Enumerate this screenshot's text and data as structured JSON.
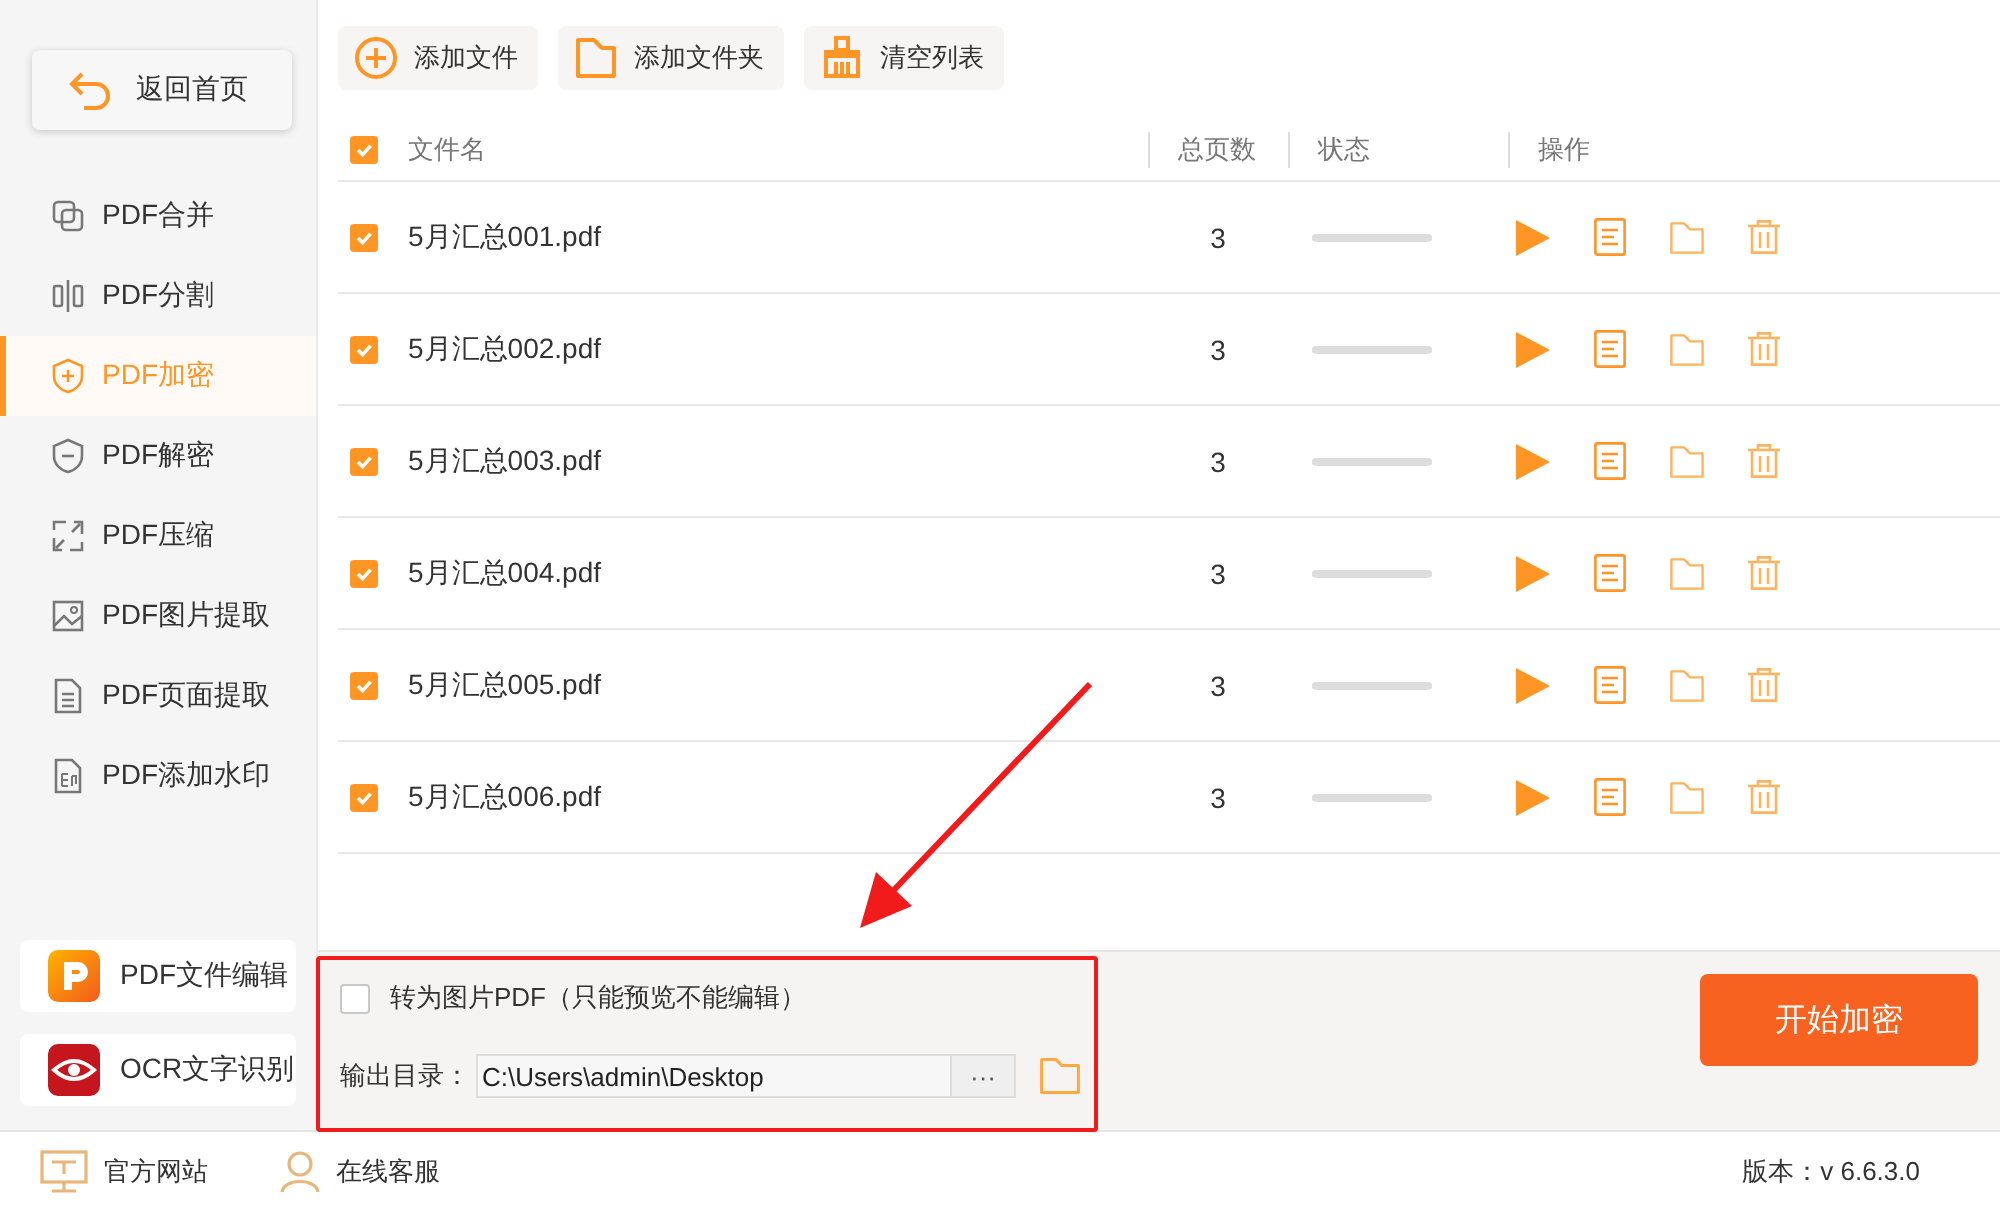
{
  "sidebar": {
    "back_button": "返回首页",
    "items": [
      {
        "label": "PDF合并",
        "kind": "merge",
        "selected": false
      },
      {
        "label": "PDF分割",
        "kind": "split",
        "selected": false
      },
      {
        "label": "PDF加密",
        "kind": "encrypt",
        "selected": true
      },
      {
        "label": "PDF解密",
        "kind": "decrypt",
        "selected": false
      },
      {
        "label": "PDF压缩",
        "kind": "compress",
        "selected": false
      },
      {
        "label": "PDF图片提取",
        "kind": "image",
        "selected": false
      },
      {
        "label": "PDF页面提取",
        "kind": "page",
        "selected": false
      },
      {
        "label": "PDF添加水印",
        "kind": "watermark",
        "selected": false
      }
    ],
    "extras": [
      {
        "label": "PDF文件编辑",
        "kind": "edit"
      },
      {
        "label": "OCR文字识别",
        "kind": "ocr"
      }
    ]
  },
  "toolbar": [
    {
      "label": "添加文件",
      "kind": "add-file"
    },
    {
      "label": "添加文件夹",
      "kind": "add-folder"
    },
    {
      "label": "清空列表",
      "kind": "clear"
    }
  ],
  "table": {
    "all_checked": true,
    "columns": [
      "文件名",
      "总页数",
      "状态",
      "操作"
    ],
    "rows": [
      {
        "checked": true,
        "name": "5月汇总001.pdf",
        "pages": "3",
        "level": 0
      },
      {
        "checked": true,
        "name": "5月汇总002.pdf",
        "pages": "3",
        "level": 0
      },
      {
        "checked": true,
        "name": "5月汇总003.pdf",
        "pages": "3",
        "level": 0
      },
      {
        "checked": true,
        "name": "5月汇总004.pdf",
        "pages": "3",
        "level": 0
      },
      {
        "checked": true,
        "name": "5月汇总005.pdf",
        "pages": "3",
        "level": 0
      },
      {
        "checked": true,
        "name": "5月汇总006.pdf",
        "pages": "3",
        "level": 0
      }
    ]
  },
  "options": {
    "convert_checked": false,
    "convert_label": "转为图片PDF（只能预览不能编辑）",
    "output_label": "输出目录：",
    "output_path": "C:\\Users\\admin\\Desktop",
    "browse_button": "···"
  },
  "start_button": "开始加密",
  "footer": {
    "links": [
      {
        "label": "官方网站",
        "kind": "website"
      },
      {
        "label": "在线客服",
        "kind": "support"
      }
    ],
    "version": "版本：v 6.6.3.0"
  }
}
